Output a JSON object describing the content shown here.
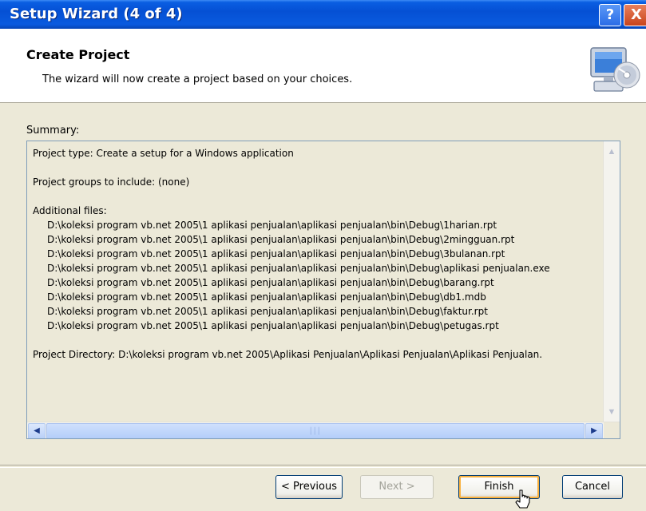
{
  "window": {
    "title": "Setup Wizard (4 of 4)"
  },
  "titlebar_buttons": {
    "help": "?",
    "close": "X"
  },
  "header": {
    "title": "Create Project",
    "subtitle": "The wizard will now create a project based on your choices.",
    "icon": "computer-cd-icon"
  },
  "summary": {
    "label": "Summary:",
    "project_type": "Project type: Create a setup for a Windows application",
    "project_groups": "Project groups to include: (none)",
    "additional_files_label": "Additional files:",
    "files": [
      "D:\\koleksi program vb.net 2005\\1 aplikasi penjualan\\aplikasi penjualan\\bin\\Debug\\1harian.rpt",
      "D:\\koleksi program vb.net 2005\\1 aplikasi penjualan\\aplikasi penjualan\\bin\\Debug\\2mingguan.rpt",
      "D:\\koleksi program vb.net 2005\\1 aplikasi penjualan\\aplikasi penjualan\\bin\\Debug\\3bulanan.rpt",
      "D:\\koleksi program vb.net 2005\\1 aplikasi penjualan\\aplikasi penjualan\\bin\\Debug\\aplikasi penjualan.exe",
      "D:\\koleksi program vb.net 2005\\1 aplikasi penjualan\\aplikasi penjualan\\bin\\Debug\\barang.rpt",
      "D:\\koleksi program vb.net 2005\\1 aplikasi penjualan\\aplikasi penjualan\\bin\\Debug\\db1.mdb",
      "D:\\koleksi program vb.net 2005\\1 aplikasi penjualan\\aplikasi penjualan\\bin\\Debug\\faktur.rpt",
      "D:\\koleksi program vb.net 2005\\1 aplikasi penjualan\\aplikasi penjualan\\bin\\Debug\\petugas.rpt"
    ],
    "project_directory": "Project Directory: D:\\koleksi program vb.net 2005\\Aplikasi Penjualan\\Aplikasi Penjualan\\Aplikasi Penjualan."
  },
  "buttons": {
    "previous": "< Previous",
    "next": "Next >",
    "finish": "Finish",
    "cancel": "Cancel"
  }
}
